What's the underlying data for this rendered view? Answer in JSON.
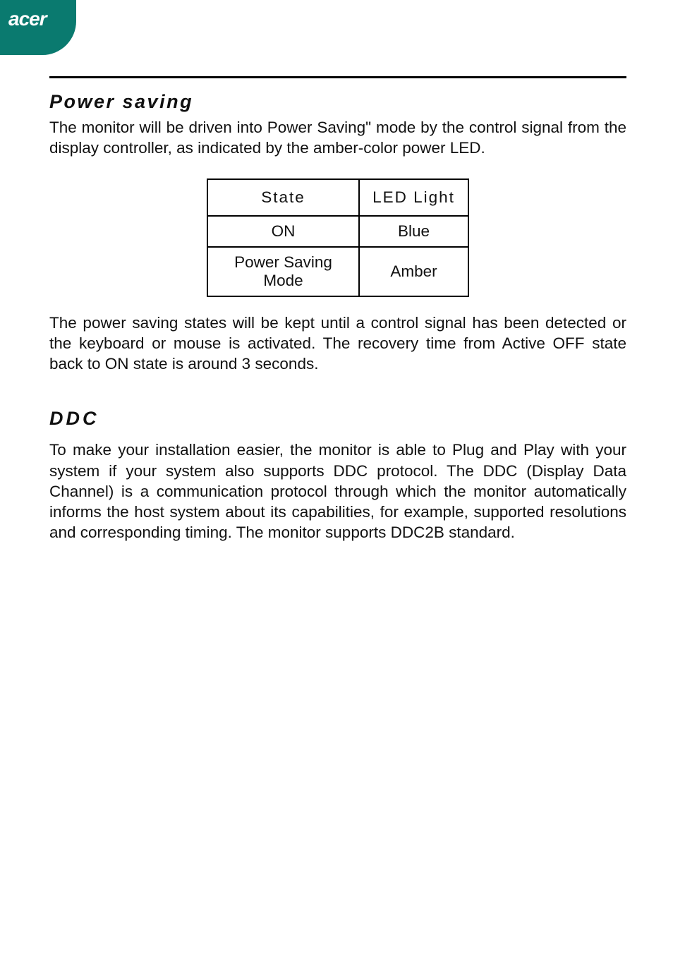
{
  "brand": "acer",
  "sections": {
    "power_saving": {
      "heading": "Power saving",
      "intro": "The monitor will be driven into Power Saving\" mode by the control signal from the display controller, as indicated by the amber-color power LED.",
      "outro": "The power saving states will be kept until a control signal has been detected or the keyboard or mouse is activated. The recovery time from Active OFF state back to ON state is around 3 seconds."
    },
    "ddc": {
      "heading": "DDC",
      "text": "To make your installation easier, the monitor is able to Plug and Play with your system if your system also supports DDC protocol. The DDC (Display Data Channel) is a communication protocol through which the monitor automatically informs the host system about its capabilities, for example, supported resolutions and corresponding timing. The monitor supports DDC2B standard."
    }
  },
  "table": {
    "headers": {
      "state": "State",
      "led": "LED Light"
    },
    "rows": [
      {
        "state": "ON",
        "led": "Blue"
      },
      {
        "state": "Power Saving Mode",
        "led": "Amber"
      }
    ]
  }
}
